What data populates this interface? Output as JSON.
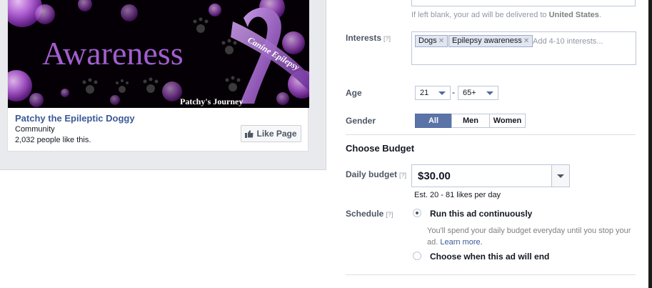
{
  "preview": {
    "image_title": "Awareness",
    "ribbon_text": "Canine Epilepsy",
    "caption": "Patchy's Journey",
    "page_name": "Patchy the Epileptic Doggy",
    "page_type": "Community",
    "page_likes": "2,032 people like this.",
    "like_button": "Like Page",
    "colors": {
      "purple": "#9b4fc7",
      "link": "#3b5998"
    }
  },
  "location": {
    "hint_prefix": "If left blank, your ad will be delivered to",
    "hint_country": "United States"
  },
  "interests": {
    "label": "Interests",
    "help": "[?]",
    "tokens": [
      "Dogs",
      "Epilepsy awareness"
    ],
    "placeholder": "Add 4-10 interests..."
  },
  "age": {
    "label": "Age",
    "min": "21",
    "separator": "-",
    "max": "65+"
  },
  "gender": {
    "label": "Gender",
    "options": [
      "All",
      "Men",
      "Women"
    ],
    "selected": "All"
  },
  "budget": {
    "section_title": "Choose Budget",
    "label": "Daily budget",
    "help": "[?]",
    "value": "$30.00",
    "estimate": "Est. 20 - 81 likes per day"
  },
  "schedule": {
    "label": "Schedule",
    "help": "[?]",
    "option_continuous": "Run this ad continuously",
    "description": "You'll spend your daily budget everyday until you stop your ad.",
    "learn_more": "Learn more.",
    "option_end": "Choose when this ad will end"
  }
}
